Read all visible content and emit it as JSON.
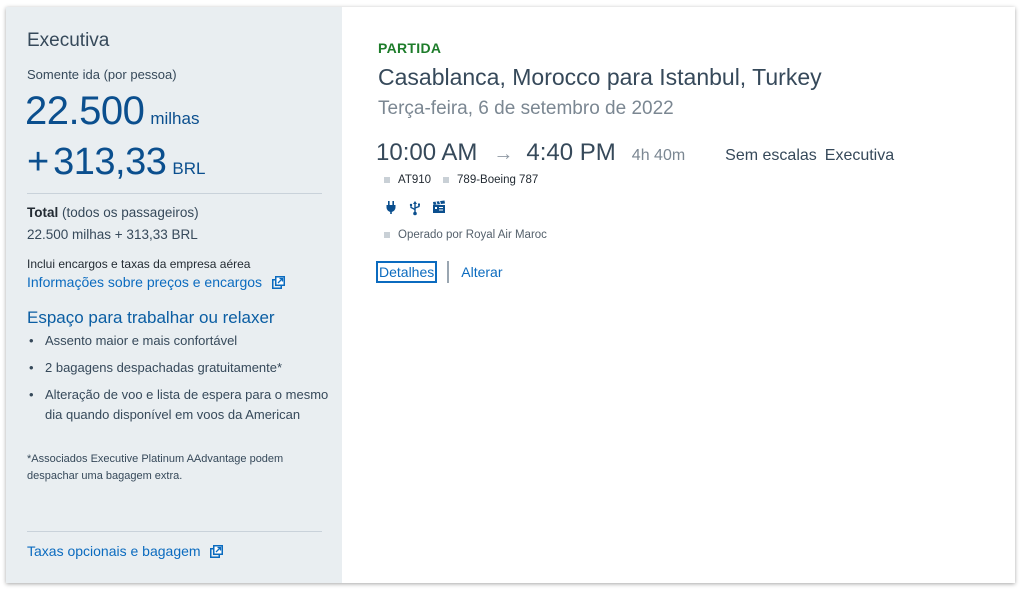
{
  "summary": {
    "cabin": "Executiva",
    "fare_type": "Somente ida (por pessoa)",
    "miles": "22.500",
    "miles_unit": "milhas",
    "cash_prefix": "+",
    "cash": "313,33",
    "currency": "BRL",
    "total_label": "Total",
    "total_qualifier": "(todos os passageiros)",
    "total_value": "22.500 milhas + 313,33 BRL",
    "taxes_note": "Inclui encargos e taxas da empresa aérea",
    "pricing_link": "Informações sobre preços e encargos"
  },
  "benefits": {
    "title": "Espaço para trabalhar ou relaxer",
    "items": [
      "Assento maior e mais confortável",
      "2 bagagens despachadas gratuitamente*",
      "Alteração de voo e lista de espera para o mesmo dia quando disponível em voos da American"
    ],
    "footnote": "*Associados Executive Platinum AAdvantage podem despachar uma bagagem extra."
  },
  "footer_link": "Taxas opcionais e bagagem",
  "flight": {
    "label": "PARTIDA",
    "route": "Casablanca, Morocco para Istanbul, Turkey",
    "date": "Terça-feira, 6 de setembro de 2022",
    "depart_time": "10:00 AM",
    "arrive_time": "4:40 PM",
    "duration": "4h 40m",
    "stops": "Sem escalas",
    "cabin": "Executiva",
    "flight_number": "AT910",
    "aircraft": "789-Boeing 787",
    "amenities": [
      "power-outlet-icon",
      "usb-icon",
      "entertainment-icon"
    ],
    "operated_by": "Operado por Royal Air Maroc",
    "details_label": "Detalhes",
    "change_label": "Alterar"
  },
  "colors": {
    "panel_bg": "#e9eef1",
    "accent_blue": "#0b6bbf",
    "departure_green": "#1d7c2a",
    "text": "#36495a"
  }
}
